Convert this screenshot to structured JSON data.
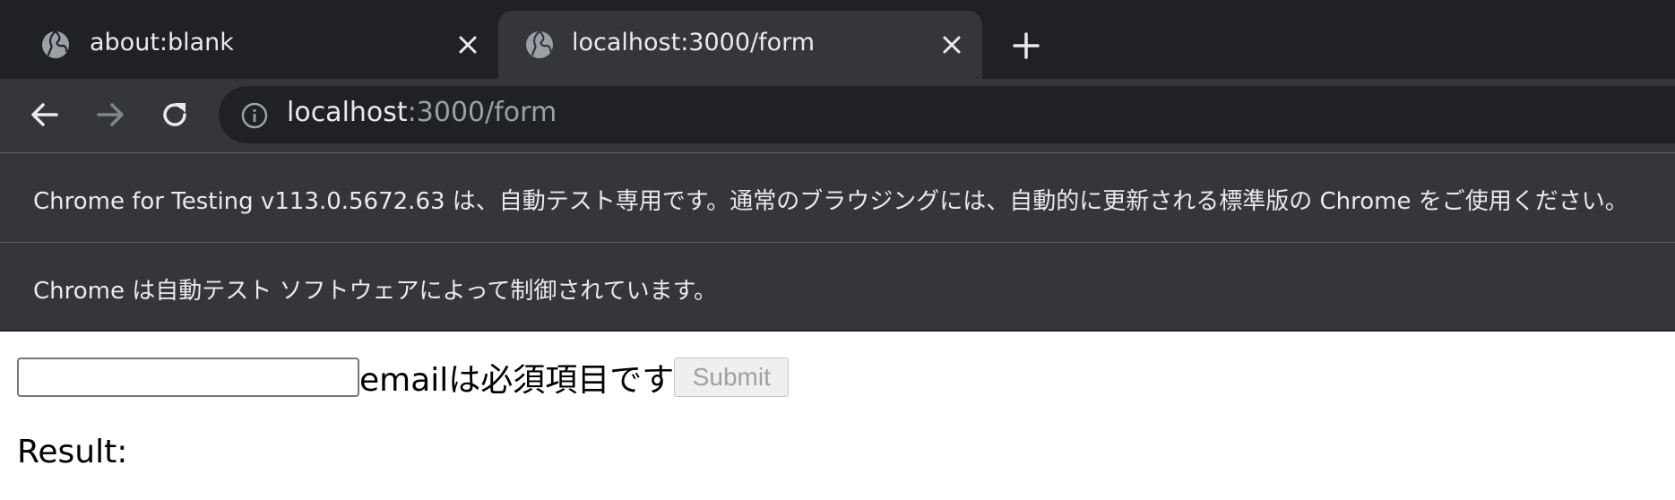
{
  "browser": {
    "tabs": [
      {
        "title": "about:blank",
        "active": false
      },
      {
        "title": "localhost:3000/form",
        "active": true
      }
    ],
    "address_bar": {
      "host": "localhost",
      "path": ":3000/form"
    },
    "infobars": [
      "Chrome for Testing v113.0.5672.63 は、自動テスト専用です。通常のブラウジングには、自動的に更新される標準版の Chrome をご使用ください。",
      "Chrome は自動テスト ソフトウェアによって制御されています。"
    ],
    "colors": {
      "tabstrip": "#202124",
      "toolbar": "#35363a",
      "omnibox": "#202124",
      "text": "#e8eaed",
      "muted": "#9aa0a6"
    }
  },
  "form": {
    "email_value": "",
    "error_message": "emailは必須項目です",
    "submit_label": "Submit",
    "submit_disabled": true
  },
  "result": {
    "label": "Result:"
  }
}
